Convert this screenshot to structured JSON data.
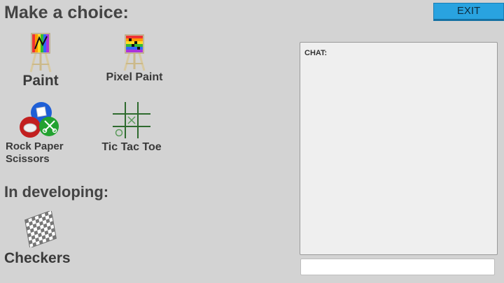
{
  "header": {
    "title": "Make a choice:",
    "exit_label": "EXIT"
  },
  "games": [
    {
      "label": "Paint",
      "icon": "easel-paint-icon"
    },
    {
      "label": "Pixel Paint",
      "icon": "easel-pixel-paint-icon"
    },
    {
      "label": "Rock Paper\nScissors",
      "icon": "rock-paper-scissors-icon"
    },
    {
      "label": "Tic Tac Toe",
      "icon": "tic-tac-toe-icon"
    }
  ],
  "developing": {
    "title": "In developing:",
    "games": [
      {
        "label": "Checkers",
        "icon": "checkers-board-icon"
      }
    ]
  },
  "chat": {
    "label": "CHAT:",
    "input_value": "",
    "input_placeholder": ""
  },
  "colors": {
    "background": "#d3d3d3",
    "exit_button": "#29a3e0",
    "chat_panel": "#efefef"
  }
}
